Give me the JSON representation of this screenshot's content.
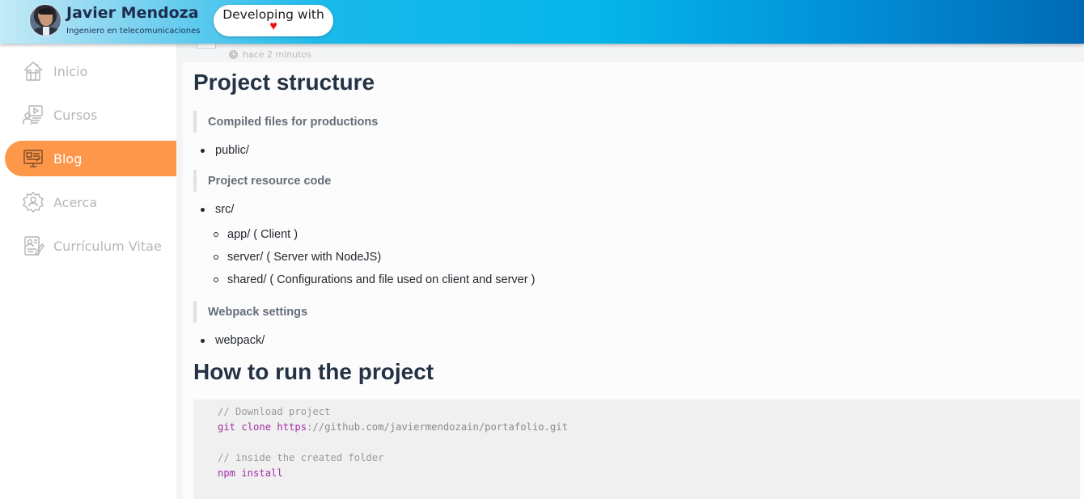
{
  "header": {
    "name": "Javier Mendoza",
    "subtitle": "Ingeniero en telecomunicaciones",
    "developing_text": "Developing with",
    "heart_glyph": "♥",
    "gradient_colors": [
      "#c4eaf6",
      "#05b6ea",
      "#0069b4"
    ]
  },
  "sidebar": {
    "active_color": "#fd974a",
    "items": [
      {
        "label": "Inicio",
        "icon": "home-icon",
        "active": false
      },
      {
        "label": "Cursos",
        "icon": "courses-icon",
        "active": false
      },
      {
        "label": "Blog",
        "icon": "blog-icon",
        "active": true
      },
      {
        "label": "Acerca",
        "icon": "about-badge-icon",
        "active": false
      },
      {
        "label": "Currículum Vitae",
        "icon": "cv-document-icon",
        "active": false
      }
    ]
  },
  "article": {
    "time_ago": "hace 2 minutos",
    "heading1": "Project structure",
    "quote1": "Compiled files for productions",
    "item_public": "public/",
    "quote2": "Project resource code",
    "item_src": "src/",
    "sub_items": [
      "app/ ( Client )",
      "server/ ( Server with NodeJS)",
      "shared/ ( Configurations and file used on client and server )"
    ],
    "quote3": "Webpack settings",
    "item_webpack": "webpack/",
    "heading2": "How to run the project",
    "code": {
      "comment1": "// Download project",
      "cmd1_keywords": "git clone https",
      "cmd1_rest": "://github.com/javiermendozain/portafolio.git",
      "comment2": "// inside the created folder",
      "cmd2": "npm install"
    }
  }
}
